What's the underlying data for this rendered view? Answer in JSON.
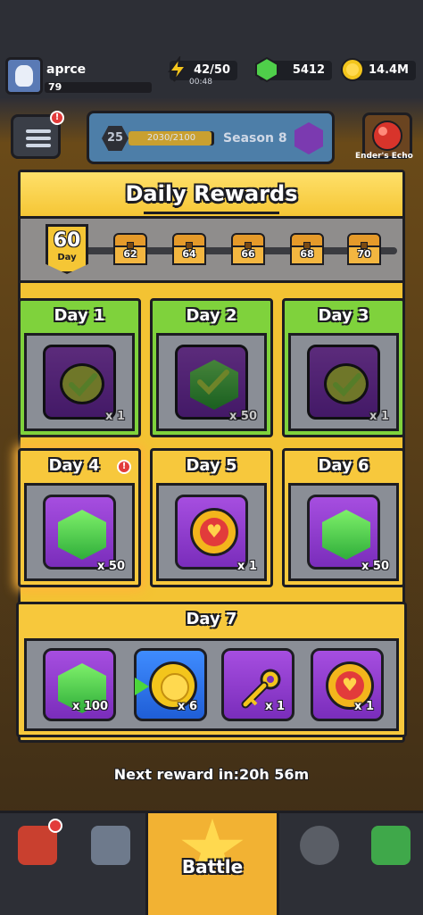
{
  "header": {
    "player_name": "aprce",
    "player_level": "79",
    "energy": "42/50",
    "energy_timer": "00:48",
    "gems": "5412",
    "coins": "14.4M"
  },
  "season": {
    "level": "25",
    "xp": "2030/2100",
    "xp_progress": 0.967,
    "name": "Season 8"
  },
  "side_buttons": {
    "echo_label": "Ender's Echo",
    "menu_badge": "!"
  },
  "dialog": {
    "title": "Daily Rewards",
    "streak_day": "60",
    "streak_label": "Day",
    "milestones": [
      "62",
      "64",
      "66",
      "68",
      "70"
    ],
    "days": [
      {
        "label": "Day 1",
        "qty": "x 1",
        "status": "claimed",
        "icon": "check-token-icon"
      },
      {
        "label": "Day 2",
        "qty": "x 50",
        "status": "claimed",
        "icon": "gem-check-icon"
      },
      {
        "label": "Day 3",
        "qty": "x 1",
        "status": "claimed",
        "icon": "check-token-icon"
      },
      {
        "label": "Day 4",
        "qty": "x 50",
        "status": "active",
        "icon": "gem-icon"
      },
      {
        "label": "Day 5",
        "qty": "x 1",
        "status": "pending",
        "icon": "heart-coin-icon"
      },
      {
        "label": "Day 6",
        "qty": "x 50",
        "status": "pending",
        "icon": "gem-icon"
      }
    ],
    "day4_badge": "!",
    "day7": {
      "label": "Day 7",
      "items": [
        {
          "qty": "x 100",
          "icon": "gem-icon"
        },
        {
          "qty": "x 6",
          "icon": "coin-arrow-icon"
        },
        {
          "qty": "x 1",
          "icon": "key-icon"
        },
        {
          "qty": "x 1",
          "icon": "heart-coin-icon"
        }
      ]
    },
    "next_reward": "Next reward in:20h 56m"
  },
  "bottom_nav": {
    "battle_label": "Battle"
  },
  "colors": {
    "claimed_green": "#7fd23c",
    "pending_yellow": "#f7c83c",
    "outline": "#1d1d22"
  }
}
